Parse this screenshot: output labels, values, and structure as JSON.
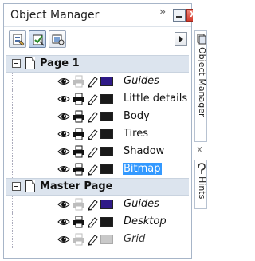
{
  "window": {
    "title": "Object Manager",
    "chevron": "»",
    "minimize_icon": "minimize-icon",
    "close_symbol": "X"
  },
  "toolbar": {
    "tools": [
      {
        "name": "show-properties-icon",
        "active": false
      },
      {
        "name": "edit-across-layers-icon",
        "active": true
      },
      {
        "name": "layer-manager-view-icon",
        "active": false
      }
    ],
    "menu_arrow": "flyout-arrow-icon"
  },
  "pages": [
    {
      "label": "Page 1",
      "layers": [
        {
          "label": "Guides",
          "italic": true,
          "color": "#2f1a87",
          "printable": false,
          "selected": false
        },
        {
          "label": "Little details",
          "italic": false,
          "color": "#1a1a1a",
          "printable": true,
          "selected": false
        },
        {
          "label": "Body",
          "italic": false,
          "color": "#1a1a1a",
          "printable": true,
          "selected": false
        },
        {
          "label": "Tires",
          "italic": false,
          "color": "#1a1a1a",
          "printable": true,
          "selected": false
        },
        {
          "label": "Shadow",
          "italic": false,
          "color": "#1a1a1a",
          "printable": true,
          "selected": false
        },
        {
          "label": "Bitmap",
          "italic": false,
          "color": "#1a1a1a",
          "printable": true,
          "selected": true
        }
      ]
    },
    {
      "label": "Master Page",
      "layers": [
        {
          "label": "Guides",
          "italic": true,
          "color": "#2f1a87",
          "printable": false,
          "selected": false
        },
        {
          "label": "Desktop",
          "italic": true,
          "color": "#1a1a1a",
          "printable": true,
          "selected": false
        },
        {
          "label": "Grid",
          "italic": true,
          "color": "#c9c9c9",
          "printable": false,
          "selected": false,
          "dim": true
        }
      ]
    }
  ],
  "dock": {
    "tab1": "Object Manager",
    "tab2": "Hints",
    "close": "x"
  },
  "colors": {
    "selection": "#3399ff",
    "header_bg": "#dce4ee",
    "accent": "#2f1a87"
  }
}
